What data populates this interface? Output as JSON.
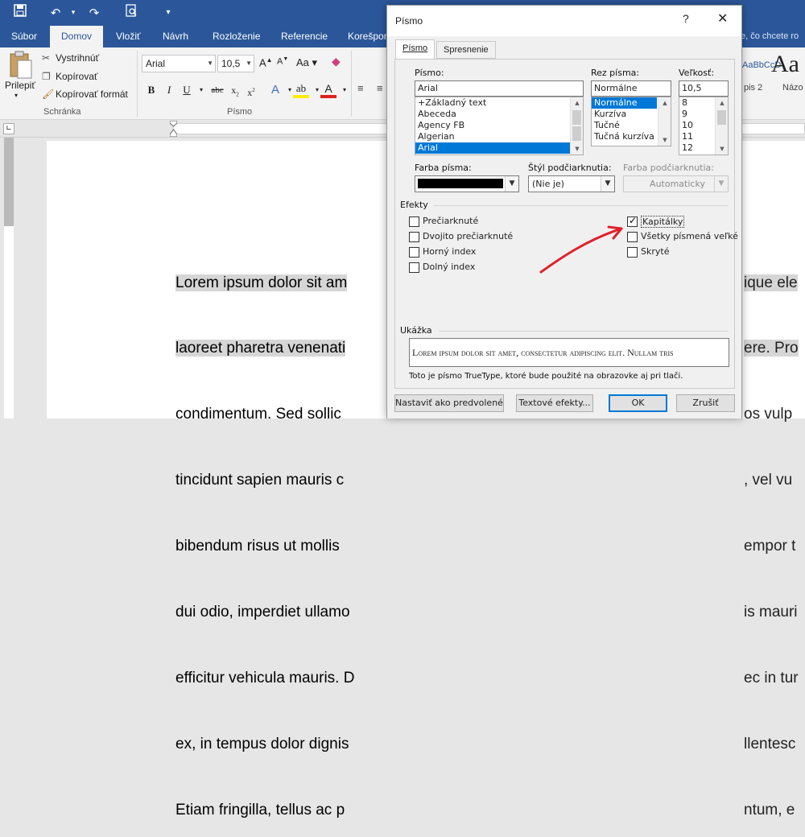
{
  "quick_access": {
    "save_icon": "save-icon",
    "undo_icon": "undo-icon",
    "redo_icon": "redo-icon",
    "print_preview_icon": "print-preview-icon"
  },
  "tabs": [
    "Súbor",
    "Domov",
    "Vložiť",
    "Návrh",
    "Rozloženie",
    "Referencie",
    "Korešpon"
  ],
  "tellme": "e, čo chcete ro",
  "ribbon": {
    "paste_label": "Prilepiť",
    "cut": "Vystrihnúť",
    "copy": "Kopírovať",
    "format_painter": "Kopírovať formát",
    "clipboard_group": "Schránka",
    "font_name": "Arial",
    "font_size": "10,5",
    "font_group": "Písmo",
    "styles_preview": "Aa",
    "styles_small": "AaBbCcD",
    "style_label_1": "pis 2",
    "style_label_2": "Názo"
  },
  "document": {
    "lines": [
      "Lorem ipsum dolor sit am",
      "laoreet pharetra venenati",
      "condimentum. Sed sollic",
      "tincidunt sapien mauris c",
      "bibendum risus ut mollis",
      "dui odio, imperdiet ullamo",
      "efficitur vehicula mauris. D",
      "ex, in tempus dolor dignis",
      "Etiam fringilla, tellus ac p"
    ],
    "right_lines": [
      "ique ele",
      "ere. Pro",
      "os vulp",
      ", vel vu",
      "empor t",
      "is mauri",
      "ec in tur",
      "llentesc",
      "ntum, e"
    ]
  },
  "dialog": {
    "title": "Písmo",
    "help": "?",
    "tabs": [
      "Písmo",
      "Spresnenie"
    ],
    "font_label": "Písmo:",
    "font_value": "Arial",
    "font_list": [
      "+Základný text",
      "Abeceda",
      "Agency FB",
      "Algerian",
      "Arial"
    ],
    "style_label": "Rez písma:",
    "style_value": "Normálne",
    "style_list": [
      "Normálne",
      "Kurzíva",
      "Tučné",
      "Tučná kurzíva"
    ],
    "size_label": "Veľkosť:",
    "size_value": "10,5",
    "size_list": [
      "8",
      "9",
      "10",
      "11",
      "12"
    ],
    "font_color_label": "Farba písma:",
    "font_color": "#000000",
    "underline_style_label": "Štýl podčiarknutia:",
    "underline_style_value": "(Nie je)",
    "underline_color_label": "Farba podčiarknutia:",
    "underline_color_value": "Automaticky",
    "effects_label": "Efekty",
    "effects_left": [
      {
        "label": "Prečiarknuté",
        "checked": false
      },
      {
        "label": "Dvojito prečiarknuté",
        "checked": false
      },
      {
        "label": "Horný index",
        "checked": false
      },
      {
        "label": "Dolný index",
        "checked": false
      }
    ],
    "effects_right": [
      {
        "label": "Kapitálky",
        "checked": true
      },
      {
        "label": "Všetky písmená veľké",
        "checked": false
      },
      {
        "label": "Skryté",
        "checked": false
      }
    ],
    "preview_label": "Ukážka",
    "preview_text": "Lorem ipsum dolor sit amet, consectetur adipiscing elit. Nullam tris",
    "truetype_note": "Toto je písmo TrueType, ktoré bude použité na obrazovke aj pri tlači.",
    "btn_default": "Nastaviť ako predvolené",
    "btn_text_effects": "Textové efekty...",
    "btn_ok": "OK",
    "btn_cancel": "Zrušiť"
  },
  "colors": {
    "title_bar": "#2b579a",
    "highlight": "#d6d6d6",
    "selection": "#0078d7",
    "annotation_arrow": "#e0202a"
  }
}
